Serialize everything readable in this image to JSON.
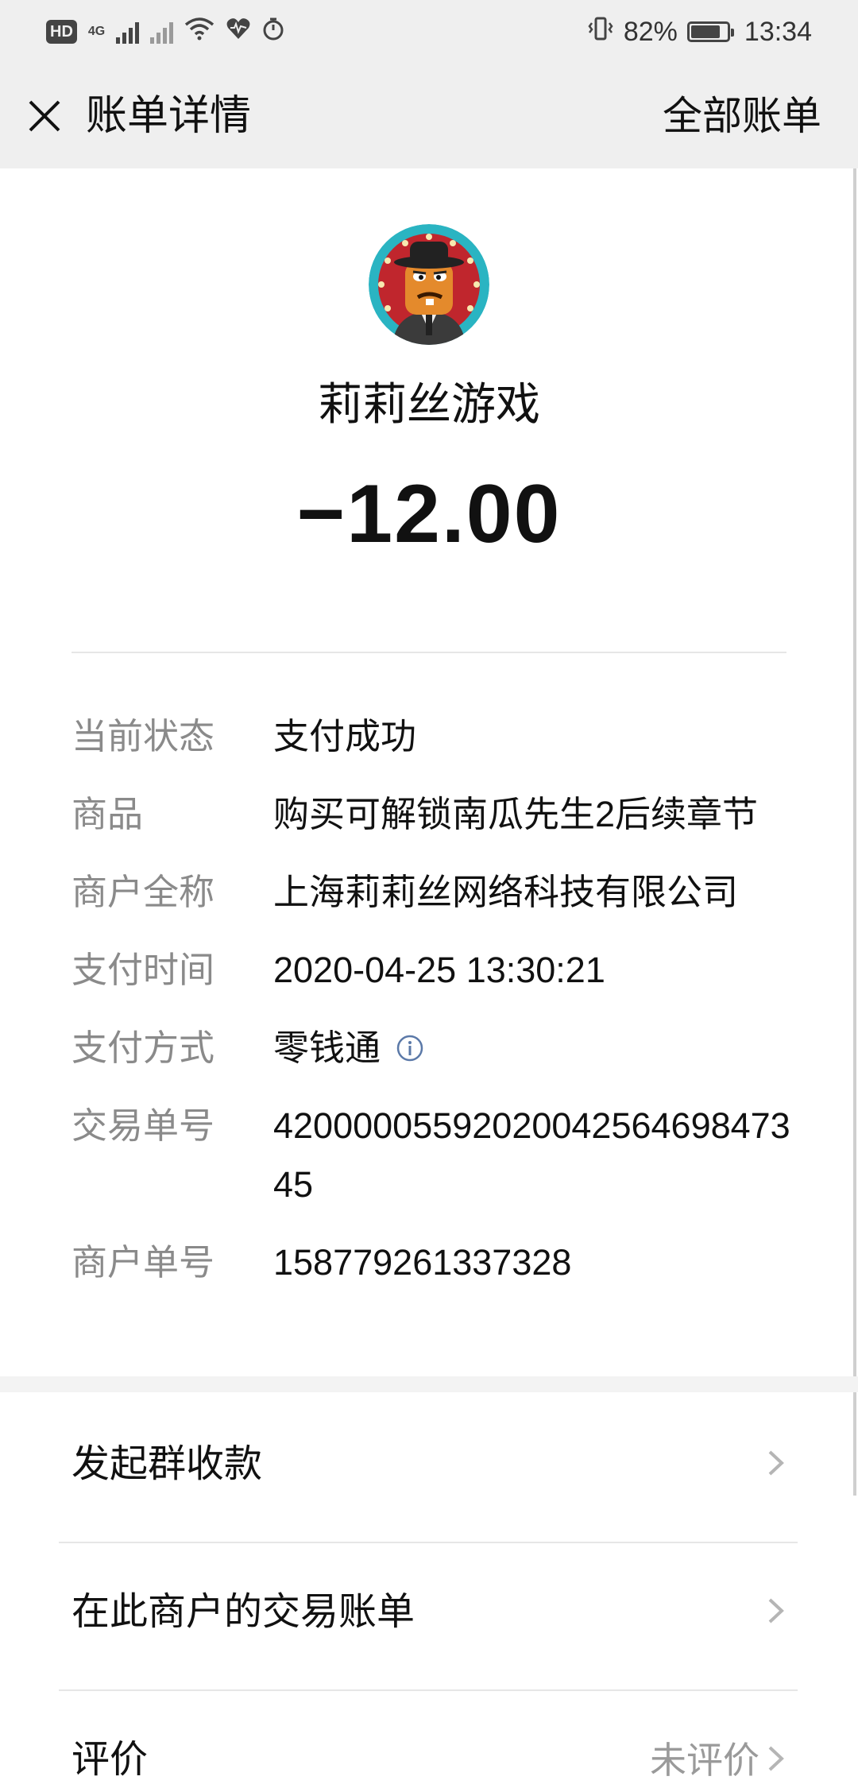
{
  "status_bar": {
    "left_chip": "HD",
    "network": "4G",
    "battery_percent_text": "82%",
    "battery_level": 0.82,
    "time": "13:34"
  },
  "header": {
    "title": "账单详情",
    "right_link": "全部账单",
    "close_icon": "close-icon"
  },
  "merchant": {
    "avatar_icon": "merchant-avatar",
    "name": "莉莉丝游戏",
    "amount": "−12.00"
  },
  "details": [
    {
      "label": "当前状态",
      "value": "支付成功"
    },
    {
      "label": "商品",
      "value": "购买可解锁南瓜先生2后续章节"
    },
    {
      "label": "商户全称",
      "value": "上海莉莉丝网络科技有限公司"
    },
    {
      "label": "支付时间",
      "value": "2020-04-25 13:30:21"
    },
    {
      "label": "支付方式",
      "value": "零钱通",
      "icon": "info-icon"
    },
    {
      "label": "交易单号",
      "value": "42000005592020042564698473 45"
    },
    {
      "label": "商户单号",
      "value": "158779261337328"
    }
  ],
  "actions": [
    {
      "label": "发起群收款",
      "status": ""
    },
    {
      "label": "在此商户的交易账单",
      "status": ""
    },
    {
      "label": "评价",
      "status": "未评价"
    }
  ],
  "colors": {
    "header_bg": "#efefef",
    "label_gray": "#8a8a8a",
    "info_blue": "#5b79a8"
  }
}
